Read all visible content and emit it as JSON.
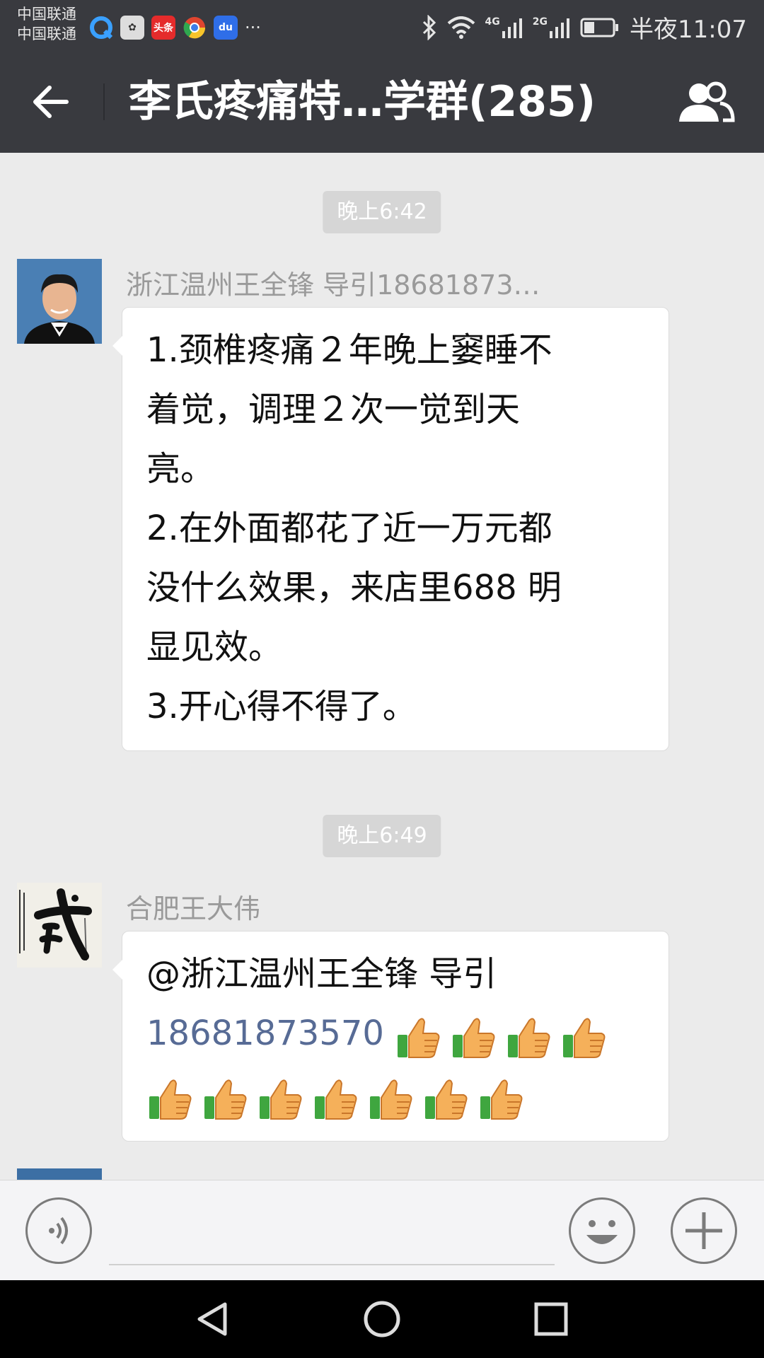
{
  "status_bar": {
    "carrier1": "中国联通",
    "carrier2": "中国联通",
    "app_icons": [
      "qq-browser-icon",
      "huawei-icon",
      "toutiao-icon",
      "chrome-icon",
      "baidu-icon"
    ],
    "toutiao_label": "头条",
    "more": "···",
    "net1": "4G",
    "net2": "2G",
    "time": "半夜11:07"
  },
  "header": {
    "title": "李氏疼痛特…学群(285)"
  },
  "chat": {
    "messages": [
      {
        "time": "晚上6:42",
        "sender": "浙江温州王全锋  导引18681873…",
        "lines": [
          "1.颈椎疼痛２年晚上窭睡不",
          "着觉，调理２次一觉到天",
          "亮。",
          "2.在外面都花了近一万元都",
          "没什么效果，来店里688 明",
          "显见效。",
          "3.开心得不得了。"
        ]
      },
      {
        "time": "晚上6:49",
        "sender": "合肥王大伟",
        "avatar_glyph": "武",
        "mention": "@浙江温州王全锋  导引",
        "phone": "18681873570",
        "thumbs_row1": 4,
        "thumbs_row2": 7
      }
    ]
  },
  "input": {
    "placeholder": ""
  },
  "colors": {
    "header_bg": "#393a3f",
    "chat_bg": "#ebebeb",
    "link": "#576b95"
  }
}
